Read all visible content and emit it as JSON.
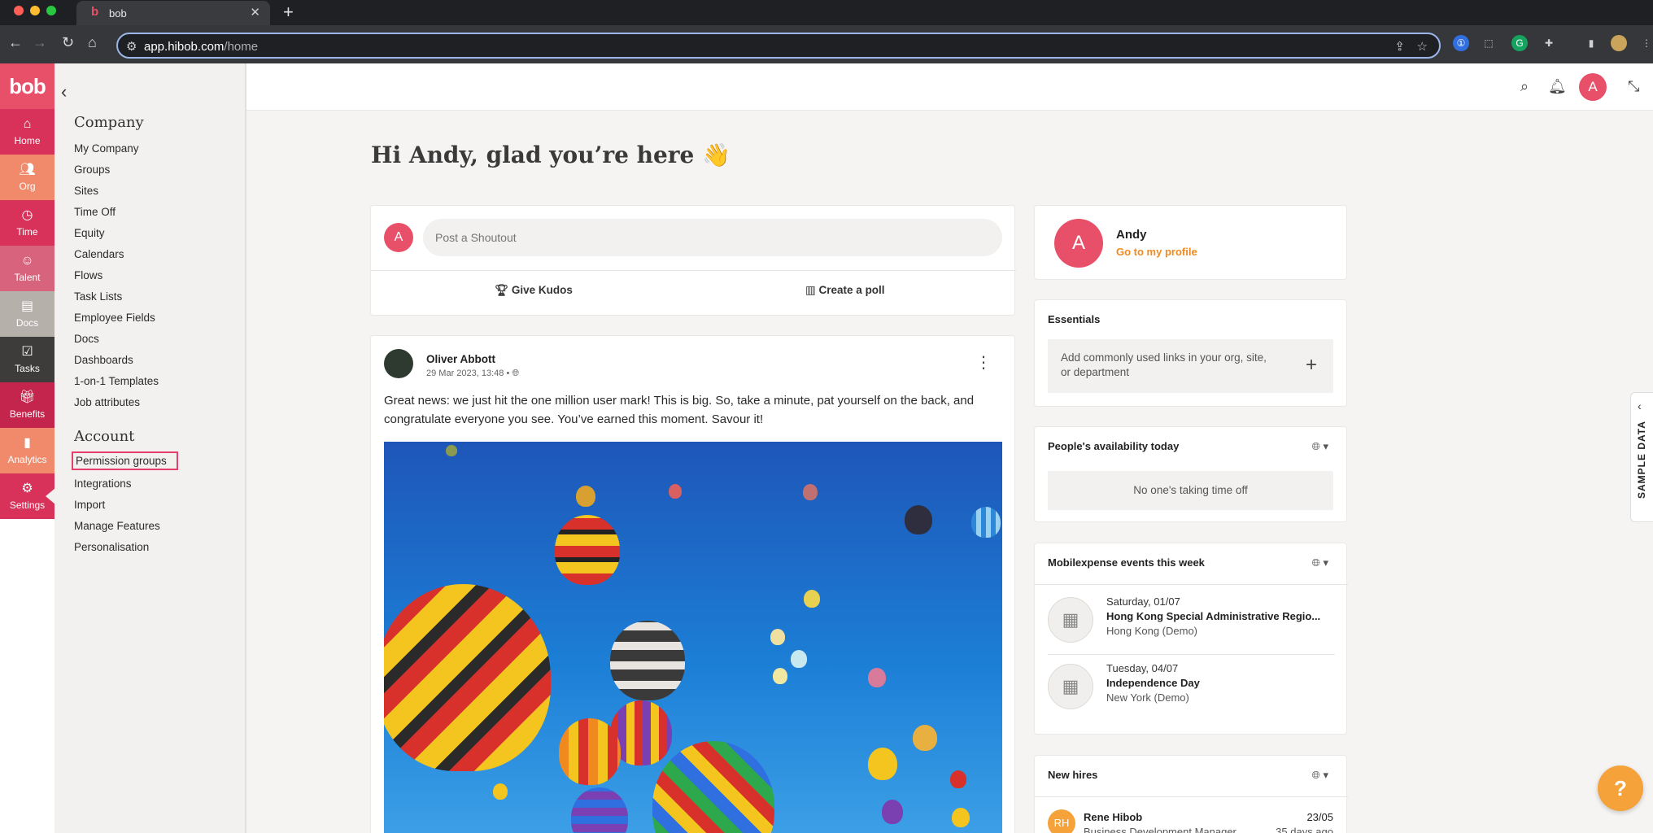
{
  "browser": {
    "tab_title": "bob",
    "url_domain": "app.hibob.com",
    "url_path": "/home"
  },
  "rail": {
    "logo": "bob",
    "items": [
      {
        "label": "Home",
        "icon": "home-icon",
        "color": "#d8315a"
      },
      {
        "label": "Org",
        "icon": "people-icon",
        "color": "#f08a6a"
      },
      {
        "label": "Time",
        "icon": "clock-icon",
        "color": "#d8315a"
      },
      {
        "label": "Talent",
        "icon": "talent-icon",
        "color": "#d8637c"
      },
      {
        "label": "Docs",
        "icon": "document-icon",
        "color": "#b6b0ab"
      },
      {
        "label": "Tasks",
        "icon": "checkbox-icon",
        "color": "#3e3c3b"
      },
      {
        "label": "Benefits",
        "icon": "gift-icon",
        "color": "#c4254d"
      },
      {
        "label": "Analytics",
        "icon": "bar-chart-icon",
        "color": "#f08a6a"
      },
      {
        "label": "Settings",
        "icon": "gear-icon",
        "color": "#d8315a"
      }
    ]
  },
  "menu": {
    "company_heading": "Company",
    "company_items": [
      "My Company",
      "Groups",
      "Sites",
      "Time Off",
      "Equity",
      "Calendars",
      "Flows",
      "Task Lists",
      "Employee Fields",
      "Docs",
      "Dashboards",
      "1-on-1 Templates",
      "Job attributes"
    ],
    "account_heading": "Account",
    "account_items": [
      "Permission groups",
      "Integrations",
      "Import",
      "Manage Features",
      "Personalisation"
    ]
  },
  "topbar": {
    "avatar_initial": "A"
  },
  "greeting": "Hi Andy, glad you’re here 👋",
  "shoutout": {
    "avatar_initial": "A",
    "placeholder": "Post a Shoutout",
    "kudos_label": "Give Kudos",
    "poll_label": "Create a poll"
  },
  "post": {
    "author": "Oliver Abbott",
    "meta": "29 Mar 2023, 13:48 •",
    "text": "Great news: we just hit the one million user mark! This is big. So, take a minute, pat yourself on the back, and congratulate everyone you see. You’ve earned this moment. Savour it!"
  },
  "profile": {
    "initial": "A",
    "name": "Andy",
    "link": "Go to my profile"
  },
  "essentials": {
    "heading": "Essentials",
    "text": "Add commonly used links in your org, site, or department"
  },
  "availability": {
    "heading": "People's availability today",
    "empty": "No one's taking time off"
  },
  "events": {
    "heading": "Mobilexpense events this week",
    "items": [
      {
        "date": "Saturday, 01/07",
        "title": "Hong Kong Special Administrative Regio...",
        "location": "Hong Kong (Demo)"
      },
      {
        "date": "Tuesday, 04/07",
        "title": "Independence Day",
        "location": "New York (Demo)"
      }
    ]
  },
  "new_hires": {
    "heading": "New hires",
    "initials": "RH",
    "name": "Rene Hibob",
    "role": "Business Development Manager",
    "date": "23/05",
    "ago": "35 days ago"
  },
  "sample_tab": "SAMPLE DATA",
  "help": "?"
}
